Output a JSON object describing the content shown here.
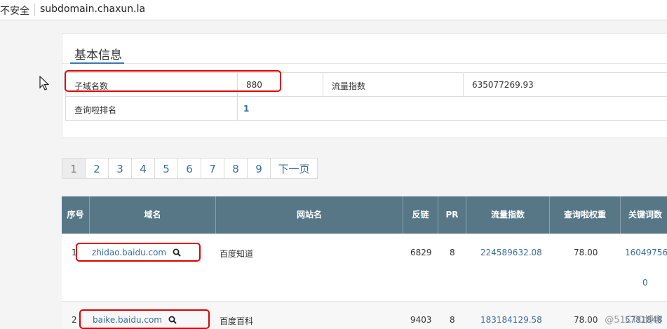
{
  "browser": {
    "security_label": "不安全",
    "url": "subdomain.chaxun.la"
  },
  "info_panel": {
    "title": "基本信息",
    "rows": [
      {
        "label": "子域名数",
        "value": "880",
        "label2": "流量指数",
        "value2": "635077269.93"
      },
      {
        "label": "查询啦排名",
        "value": "1"
      }
    ]
  },
  "pagination": {
    "pages": [
      "1",
      "2",
      "3",
      "4",
      "5",
      "6",
      "7",
      "8",
      "9"
    ],
    "active_page": "1",
    "next_label": "下一页"
  },
  "table": {
    "headers": [
      "序号",
      "域名",
      "网站名",
      "反链",
      "PR",
      "流量指数",
      "查询啦权重",
      "关键词数"
    ],
    "rows": [
      {
        "index": "1",
        "domain": "zhidao.baidu.com",
        "site_name": "百度知道",
        "backlinks": "6829",
        "pr": "8",
        "traffic": "224589632.08",
        "weight": "78.00",
        "keywords": "16049756",
        "keywords_wrap": "0"
      },
      {
        "index": "2",
        "domain": "baike.baidu.com",
        "site_name": "百度百科",
        "backlinks": "9403",
        "pr": "8",
        "traffic": "183184129.58",
        "weight": "78.00",
        "keywords": "5781848"
      }
    ]
  },
  "watermark": "@51CTO博客",
  "icons": {
    "search": "search-icon",
    "cursor": "mouse-cursor-icon"
  },
  "colors": {
    "header_bg": "#577787",
    "link": "#3a6e9f",
    "highlight": "#e00000",
    "tab_underline": "#3a77b3"
  }
}
